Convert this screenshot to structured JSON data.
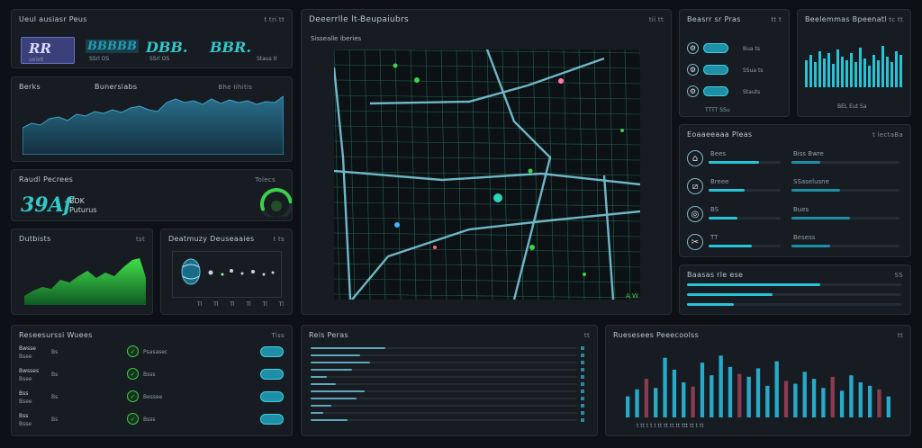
{
  "colors": {
    "bg": "#0d1014",
    "panel": "#171c22",
    "accent": "#27c4d6",
    "green": "#3bd14b",
    "map_bg": "#0c1115"
  },
  "kpi": {
    "title": "Ueul ausiasr Peus",
    "ctl": "t  tri  tt",
    "tiles": [
      {
        "value": "RR",
        "caption": "uxixti"
      },
      {
        "value": "BBBBB",
        "caption": "SSrl OS"
      },
      {
        "value": "DBB.",
        "caption": "SSrl OS"
      },
      {
        "value": "BBR.",
        "caption": "Staus tl"
      }
    ]
  },
  "area_panel": {
    "title": "Berks",
    "subtitle": "Bunersiabs",
    "tag": "Bhe Iihitis"
  },
  "status": {
    "title": "Raudl Pecrees",
    "value": "39Af",
    "label_top": "BDK",
    "label_bottom": "Puturus",
    "gauge_label": "Tolecs",
    "gauge_pct": 0.7
  },
  "green_chart": {
    "title": "Dutbists",
    "ctl": "tst"
  },
  "globe": {
    "title": "Deatmuzy Deuseaaies",
    "ctl": "t ts",
    "axis": [
      "Tl",
      "Tl",
      "Tl",
      "Tl",
      "Tl",
      "Tl"
    ]
  },
  "map": {
    "title": "Deeerrlle lt-Beupaiubrs",
    "subtitle": "Sissealle iberies",
    "ctl": "tii tt",
    "legend": "A W"
  },
  "servers": {
    "title": "Beasrr sr Pras",
    "ctl": "tt  t",
    "rows": [
      {
        "label": "Bua ts"
      },
      {
        "label": "SSua ts"
      },
      {
        "label": "Stauts"
      }
    ],
    "footer": "TTTT   SSu"
  },
  "hist": {
    "title": "Beelemmas Bpeenatl",
    "ctl": "tc  tt",
    "footer": "BEL   Eut   Sa"
  },
  "stats": {
    "title": "Eoaaeeaaa Pleas",
    "ctl": "t lectaBa",
    "rows": [
      {
        "label": "Bees",
        "right": "Biss Bwre",
        "pct": 0.7
      },
      {
        "label": "Breee",
        "right": "SSaselusne",
        "pct": 0.5
      },
      {
        "label": "BS",
        "right": "Bues",
        "pct": 0.4
      },
      {
        "label": "TT",
        "right": "Besess",
        "pct": 0.6
      }
    ]
  },
  "progress": {
    "title": "Baasas rle ese",
    "ctl": "SS",
    "bars": [
      0.62,
      0.4,
      0.22
    ]
  },
  "table": {
    "title": "Reseesurssi Wuees",
    "ctl": "Tiss",
    "rows": [
      {
        "label": "Bwsse",
        "sub": "Bsee",
        "mid": "Bs",
        "status": "Psasasec",
        "tag": "Bsee"
      },
      {
        "label": "Bwsses",
        "sub": "Bsee",
        "mid": "Bs",
        "status": "Bsss",
        "tag": "Bsee"
      },
      {
        "label": "Bss",
        "sub": "Bsee",
        "mid": "Bs",
        "status": "Bessee",
        "tag": "Bsee"
      },
      {
        "label": "Bss",
        "sub": "Bsse",
        "mid": "Bs",
        "status": "Bsss",
        "tag": "Bsee"
      }
    ]
  },
  "list": {
    "title": "Reis Peras",
    "ctl": "tt",
    "bars": [
      0.9,
      0.6,
      0.72,
      0.5,
      0.2,
      0.3,
      0.65,
      0.55,
      0.25,
      0.15,
      0.45
    ]
  },
  "bars_chart": {
    "title": "Ruesesees Peeecoolss",
    "ctl": "tt",
    "values": [
      30,
      40,
      55,
      42,
      85,
      68,
      50,
      44,
      78,
      60,
      88,
      72,
      62,
      58,
      70,
      45,
      80,
      52,
      48,
      65,
      55,
      42,
      58,
      38,
      60,
      50,
      45,
      40,
      30
    ],
    "axis": "t  tt  t  t t  tt  tt  tt tt  ttt  tt  t tt"
  }
}
